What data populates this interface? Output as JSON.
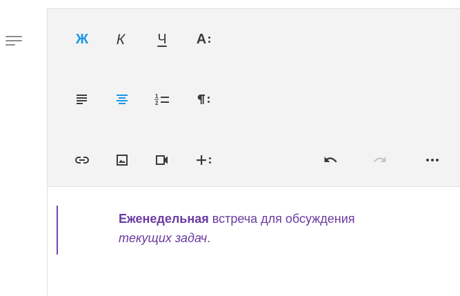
{
  "toolbar": {
    "bold_label": "Ж",
    "italic_label": "К",
    "underline_label": "Ч",
    "text_style_label": "A",
    "colors": {
      "icon": "#3a3a3a",
      "active": "#1a96e6",
      "disabled": "#c4c4c4",
      "background": "#f3f3f3"
    }
  },
  "content": {
    "bold": "Еженедельная",
    "text_1": " встреча для обсуждения ",
    "italic": "текущих задач",
    "text_2": ".",
    "text_color": "#6a3aa0",
    "quote_bar_color": "#7b3fb5"
  }
}
